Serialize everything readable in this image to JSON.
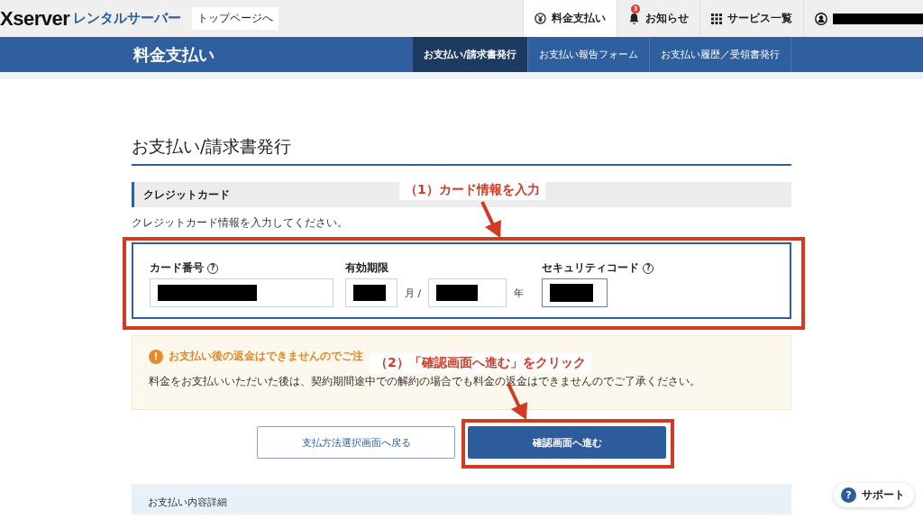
{
  "header": {
    "logo_main": "Xserver",
    "logo_sub": "レンタルサーバー",
    "top_link": "トップページへ",
    "nav": [
      {
        "kind": "yen",
        "label": "料金支払い",
        "selected": true
      },
      {
        "kind": "bell",
        "label": "お知らせ",
        "badge": "3",
        "selected": false
      },
      {
        "kind": "grid",
        "label": "サービス一覧",
        "selected": false
      },
      {
        "kind": "user",
        "selected": false
      }
    ]
  },
  "subbar": {
    "title": "料金支払い",
    "tabs": [
      {
        "label": "お支払い/請求書発行",
        "selected": true
      },
      {
        "label": "お支払い報告フォーム",
        "selected": false
      },
      {
        "label": "お支払い履歴／受領書発行",
        "selected": false
      }
    ]
  },
  "page_title": "お支払い/請求書発行",
  "section": {
    "title": "クレジットカード",
    "description": "クレジットカード情報を入力してください。",
    "fields": [
      {
        "kind": "card",
        "label": "カード番号",
        "help": "?"
      },
      {
        "kind": "expiry",
        "label": "有効期限",
        "month_unit": "月 /",
        "year_unit": "年"
      },
      {
        "kind": "cvc",
        "label": "セキュリティコード",
        "help": "?"
      }
    ]
  },
  "notice": {
    "icon": "!",
    "title": "お支払い後の返金はできませんのでご注",
    "body": "料金をお支払いいただいた後は、契約期間途中での解約の場合でも料金の返金はできませんのでご了承ください。"
  },
  "buttons": [
    {
      "kind": "secondary",
      "label": "支払方法選択画面へ戻る"
    },
    {
      "kind": "primary",
      "label": "確認画面へ進む"
    }
  ],
  "next_section": {
    "title": "お支払い内容詳細"
  },
  "support": {
    "icon": "?",
    "label": "サポート"
  },
  "annotations": [
    {
      "label": "（1）カード情報を入力"
    },
    {
      "label": "（2）「確認画面へ進む」をクリック"
    }
  ]
}
